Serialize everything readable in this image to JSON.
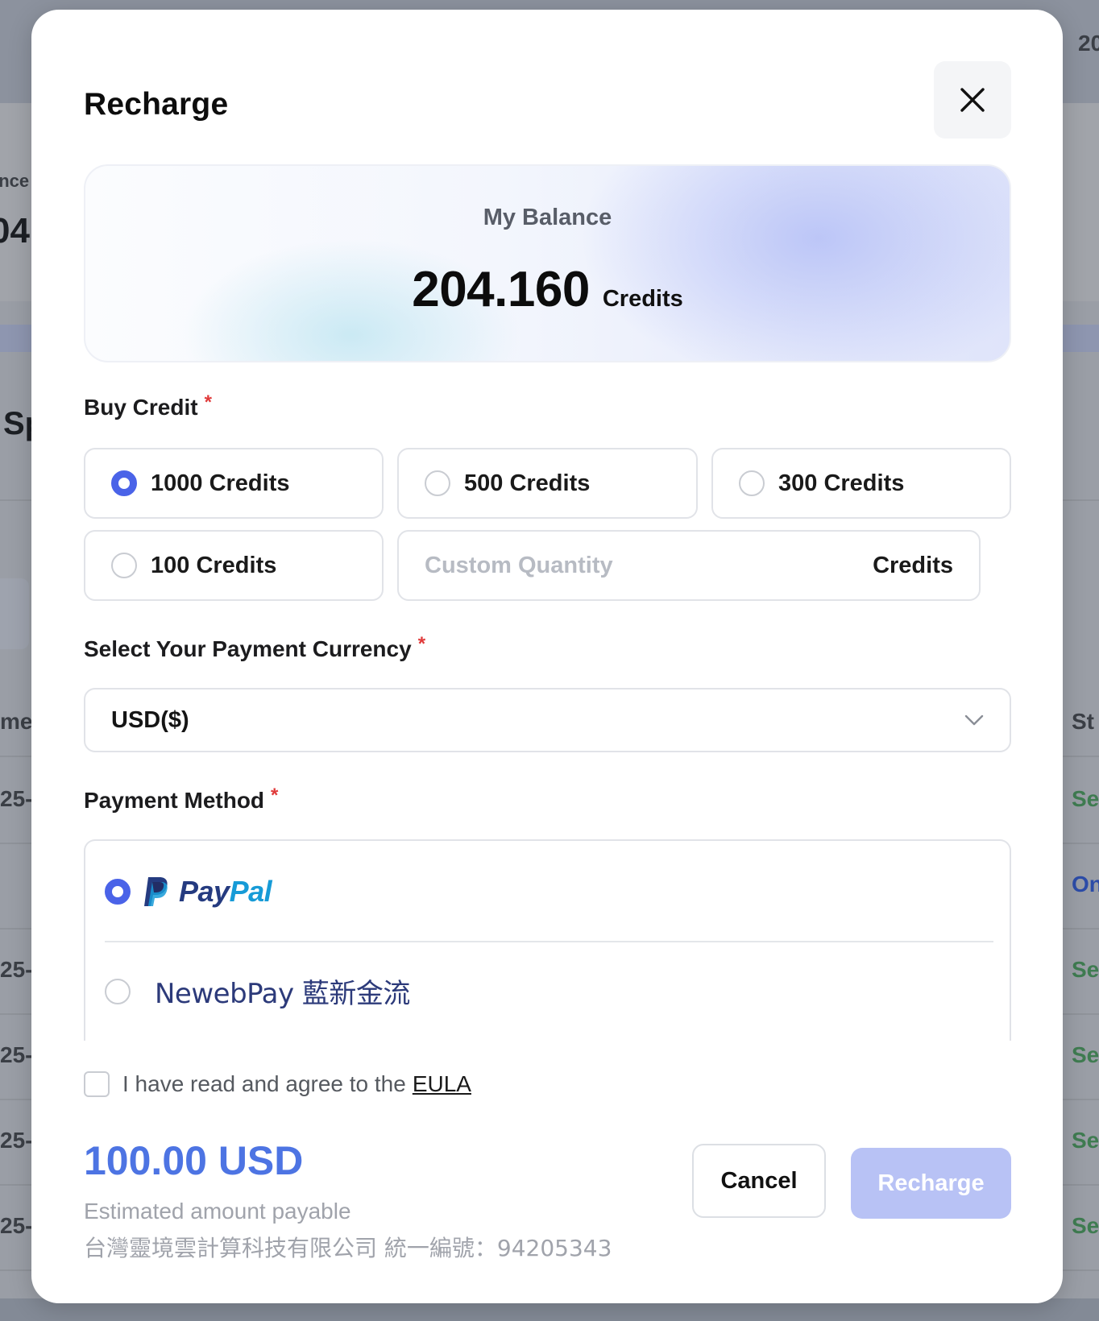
{
  "background": {
    "top_right_text": "20",
    "balance_label_fragment": "ance",
    "balance_value_fragment": "04",
    "section_fragment": "Sp",
    "column_fragment_left": "me",
    "column_fragment_right": "St",
    "rows": [
      {
        "left": "25-",
        "right": "Se"
      },
      {
        "left": "",
        "right": "On"
      },
      {
        "left": "25-",
        "right": "Se"
      },
      {
        "left": "25-",
        "right": "Se"
      },
      {
        "left": "25-",
        "right": "Se"
      },
      {
        "left": "25-",
        "right": "Se"
      }
    ]
  },
  "modal": {
    "title": "Recharge",
    "close_icon": "close-icon"
  },
  "balance": {
    "label": "My Balance",
    "amount": "204.160",
    "unit": "Credits"
  },
  "buy_credit": {
    "label": "Buy Credit",
    "required_mark": "*",
    "options": [
      {
        "label": "1000 Credits",
        "selected": true
      },
      {
        "label": "500 Credits",
        "selected": false
      },
      {
        "label": "300 Credits",
        "selected": false
      },
      {
        "label": "100 Credits",
        "selected": false
      }
    ],
    "custom": {
      "placeholder": "Custom Quantity",
      "value": "",
      "unit": "Credits"
    }
  },
  "currency": {
    "label": "Select Your Payment Currency",
    "required_mark": "*",
    "selected": "USD($)",
    "chevron_icon": "chevron-down-icon"
  },
  "payment_method": {
    "label": "Payment Method",
    "required_mark": "*",
    "options": [
      {
        "name": "PayPal",
        "name_part1": "Pay",
        "name_part2": "Pal",
        "selected": true
      },
      {
        "name": "NewebPay 藍新金流",
        "selected": false
      }
    ]
  },
  "eula": {
    "text": "I have read and agree to the",
    "link": "EULA",
    "checked": false
  },
  "footer": {
    "total": "100.00 USD",
    "note": "Estimated amount payable",
    "company": "台灣靈境雲計算科技有限公司 統一編號：94205343",
    "cancel_label": "Cancel",
    "recharge_label": "Recharge"
  },
  "colors": {
    "accent": "#4a63e8",
    "total": "#4d74e3",
    "recharge_disabled": "#b8c2f5",
    "required": "#e03a3a",
    "paypal_dark": "#253b80",
    "paypal_light": "#179bd7"
  }
}
